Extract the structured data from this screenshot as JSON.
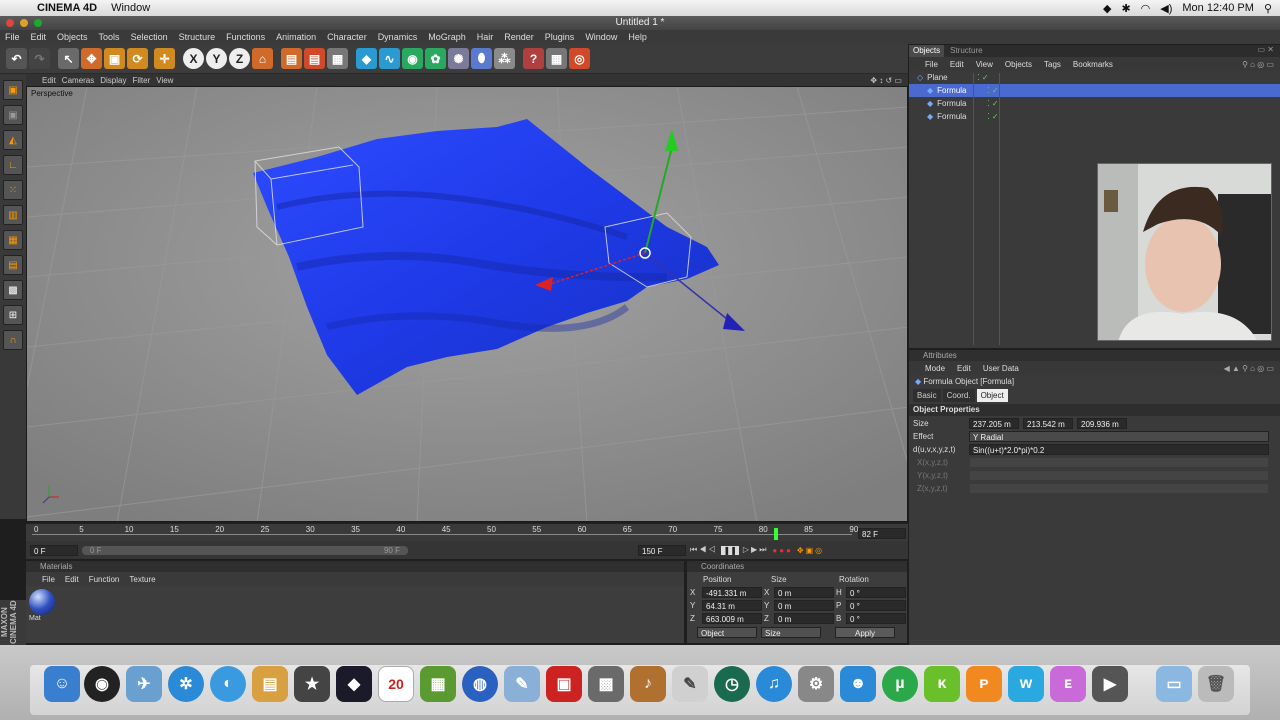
{
  "mac_menubar": {
    "app": "CINEMA 4D",
    "menus": [
      "Window"
    ],
    "clock": "Mon 12:40 PM"
  },
  "window_title": "Untitled 1 *",
  "main_menu": [
    "File",
    "Edit",
    "Objects",
    "Tools",
    "Selection",
    "Structure",
    "Functions",
    "Animation",
    "Character",
    "Dynamics",
    "MoGraph",
    "Hair",
    "Render",
    "Plugins",
    "Window",
    "Help"
  ],
  "viewport": {
    "menu": [
      "Edit",
      "Cameras",
      "Display",
      "Filter",
      "View"
    ],
    "label": "Perspective"
  },
  "timeline": {
    "ticks": [
      "0",
      "5",
      "10",
      "15",
      "20",
      "25",
      "30",
      "35",
      "40",
      "45",
      "50",
      "55",
      "60",
      "65",
      "70",
      "75",
      "80",
      "85",
      "90"
    ],
    "current_frame": "82 F",
    "start_field": "0 F",
    "slider_start": "0 F",
    "slider_end": "90 F",
    "end_field": "150 F"
  },
  "materials": {
    "title": "Materials",
    "menu": [
      "File",
      "Edit",
      "Function",
      "Texture"
    ],
    "items": [
      {
        "name": "Mat"
      }
    ]
  },
  "coordinates": {
    "title": "Coordinates",
    "headers": [
      "Position",
      "Size",
      "Rotation"
    ],
    "rows": [
      {
        "axis": "X",
        "pos": "-491.331 m",
        "size_axis": "X",
        "size": "0 m",
        "rot_axis": "H",
        "rot": "0 °"
      },
      {
        "axis": "Y",
        "pos": "64.31 m",
        "size_axis": "Y",
        "size": "0 m",
        "rot_axis": "P",
        "rot": "0 °"
      },
      {
        "axis": "Z",
        "pos": "663.009 m",
        "size_axis": "Z",
        "size": "0 m",
        "rot_axis": "B",
        "rot": "0 °"
      }
    ],
    "mode1": "Object",
    "mode2": "Size",
    "apply": "Apply"
  },
  "objects_panel": {
    "tabs": [
      "Objects",
      "Structure"
    ],
    "menu": [
      "File",
      "Edit",
      "View",
      "Objects",
      "Tags",
      "Bookmarks"
    ],
    "items": [
      "Plane",
      "Formula",
      "Formula",
      "Formula"
    ]
  },
  "attributes": {
    "title": "Attributes",
    "menu": [
      "Mode",
      "Edit",
      "User Data"
    ],
    "object_title": "Formula Object [Formula]",
    "tabs": [
      "Basic",
      "Coord.",
      "Object"
    ],
    "section": "Object Properties",
    "size_label": "Size",
    "size_values": [
      "237.205 m",
      "213.542 m",
      "209.936 m"
    ],
    "effect_label": "Effect",
    "effect_value": "Y Radial",
    "d_label": "d(u,v,x,y,z,t)",
    "d_value": "Sin((u+t)*2.0*pi)*0.2",
    "disabled_labels": [
      "X(x,y,z,t)",
      "Y(x,y,z,t)",
      "Z(x,y,z,t)"
    ]
  },
  "side_logo": "MAXON CINEMA 4D",
  "dock_calendar_day": "20"
}
